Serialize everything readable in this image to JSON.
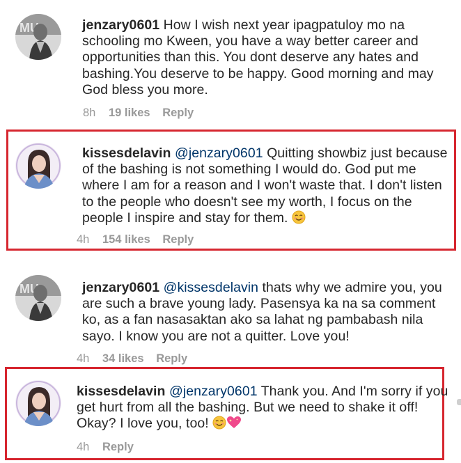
{
  "comments": [
    {
      "username": "jenzary0601",
      "mention": "",
      "lines": [
        " How I wish next year ipagpatuloy mo na",
        "schooling mo Kween, you have a way better career and",
        "opportunities than this. You dont deserve any hates and",
        "bashing.You deserve to be happy. Good morning and may",
        "God bless you more."
      ],
      "time": "8h",
      "likes": "19 likes",
      "reply": "Reply"
    },
    {
      "username": "kissesdelavin",
      "mention": "@jenzary0601",
      "lines": [
        " Quitting showbiz just because",
        "of the bashing is not something I would do. God put me",
        "where I am for a reason and I won't waste that. I don't listen",
        "to the people who doesn't see my worth, I focus on the",
        "people I inspire and stay for them. "
      ],
      "time": "4h",
      "likes": "154 likes",
      "reply": "Reply"
    },
    {
      "username": "jenzary0601",
      "mention": "@kissesdelavin",
      "lines": [
        " thats why we admire you, you",
        "are such a brave young lady. Pasensya ka na sa comment",
        "ko, as a fan nasasaktan ako sa lahat ng pambabash nila",
        "sayo. I know you are not a quitter. Love you!"
      ],
      "time": "4h",
      "likes": "34 likes",
      "reply": "Reply"
    },
    {
      "username": "kissesdelavin",
      "mention": "@jenzary0601",
      "lines": [
        " Thank you. And I'm sorry if you",
        "get hurt from all the bashing. But we need to shake it off!",
        "Okay? I love you, too! "
      ],
      "time": "4h",
      "likes": "",
      "reply": "Reply"
    }
  ],
  "colors": {
    "text": "#262626",
    "mention": "#003569",
    "meta": "#999999",
    "highlight_border": "#d6262f"
  },
  "icons": [
    "smiling-face-emoji",
    "sparkling-heart-emoji"
  ]
}
